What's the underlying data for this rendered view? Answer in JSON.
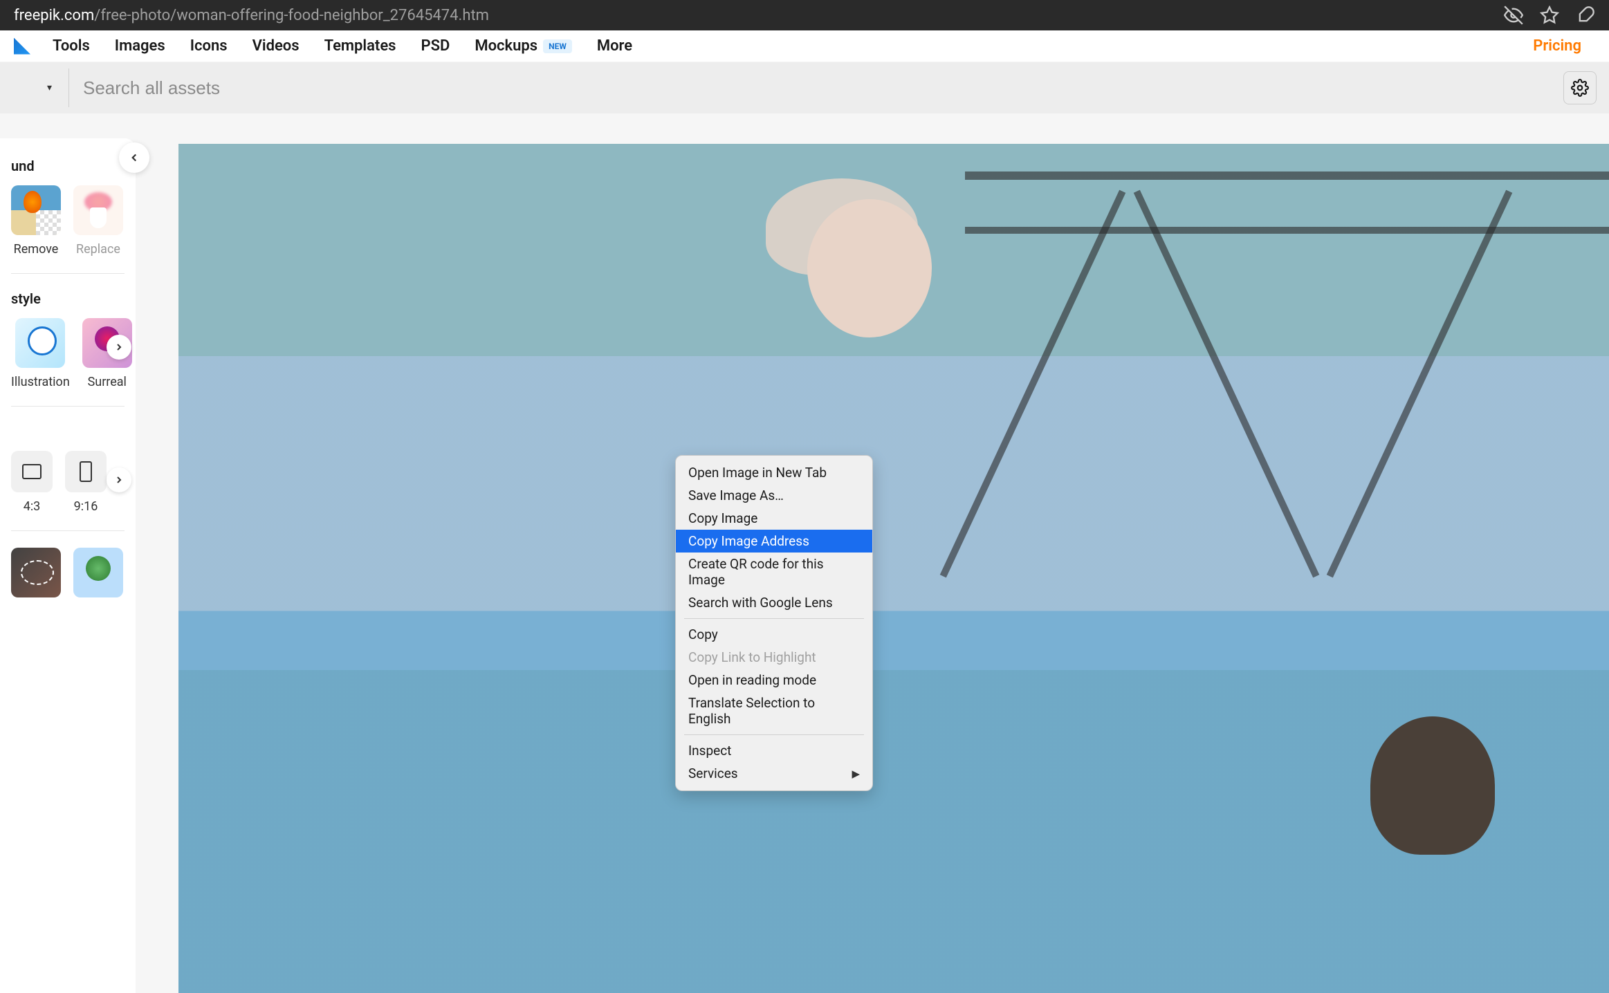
{
  "browser": {
    "url_domain": "freepik.com",
    "url_path": "/free-photo/woman-offering-food-neighbor_27645474.htm"
  },
  "nav": {
    "items": [
      "Tools",
      "Images",
      "Icons",
      "Videos",
      "Templates",
      "PSD",
      "Mockups",
      "More"
    ],
    "mockups_badge": "NEW",
    "pricing": "Pricing"
  },
  "search": {
    "placeholder": "Search all assets"
  },
  "sidebar": {
    "section_bg_partial": "und",
    "bg_items": [
      {
        "label": "Remove",
        "muted": false
      },
      {
        "label": "Replace",
        "muted": true
      }
    ],
    "section_style": "style",
    "style_items": [
      {
        "label": "Illustration"
      },
      {
        "label": "Surreal"
      }
    ],
    "ratios": [
      {
        "label": "4:3"
      },
      {
        "label": "9:16"
      }
    ]
  },
  "context_menu": {
    "items": [
      {
        "label": "Open Image in New Tab",
        "state": "normal"
      },
      {
        "label": "Save Image As…",
        "state": "normal"
      },
      {
        "label": "Copy Image",
        "state": "normal"
      },
      {
        "label": "Copy Image Address",
        "state": "highlighted"
      },
      {
        "label": "Create QR code for this Image",
        "state": "normal"
      },
      {
        "label": "Search with Google Lens",
        "state": "normal"
      },
      {
        "sep": true
      },
      {
        "label": "Copy",
        "state": "normal"
      },
      {
        "label": "Copy Link to Highlight",
        "state": "disabled"
      },
      {
        "label": "Open in reading mode",
        "state": "normal"
      },
      {
        "label": "Translate Selection to English",
        "state": "normal"
      },
      {
        "sep": true
      },
      {
        "label": "Inspect",
        "state": "normal"
      },
      {
        "label": "Services",
        "state": "normal",
        "submenu": true
      }
    ]
  }
}
